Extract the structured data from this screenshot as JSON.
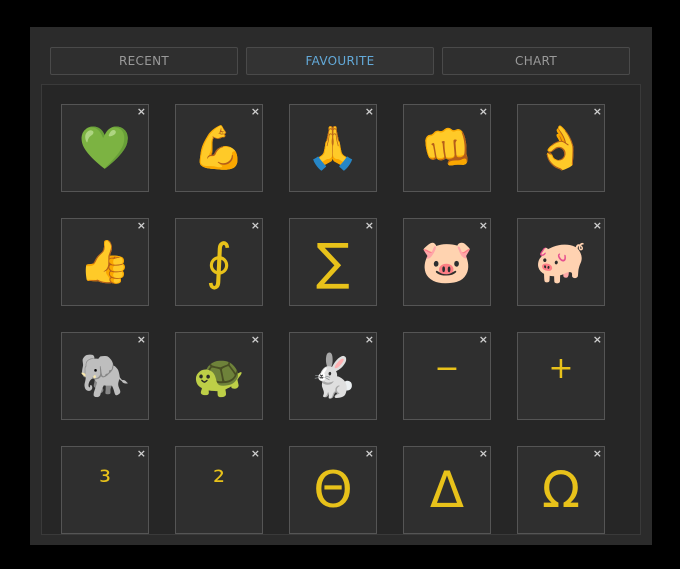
{
  "tabs": [
    {
      "label": "RECENT",
      "active": false
    },
    {
      "label": "FAVOURITE",
      "active": true
    },
    {
      "label": "CHART",
      "active": false
    }
  ],
  "accent_color": "#63a9d8",
  "symbol_color": "#e8c21a",
  "close_glyph": "×",
  "favourites": [
    {
      "symbol": "💚",
      "kind": "emoji",
      "name": "green-heart"
    },
    {
      "symbol": "💪",
      "kind": "emoji",
      "name": "flexed-biceps"
    },
    {
      "symbol": "🙏",
      "kind": "emoji",
      "name": "folded-hands"
    },
    {
      "symbol": "👊",
      "kind": "emoji",
      "name": "oncoming-fist"
    },
    {
      "symbol": "👌",
      "kind": "emoji",
      "name": "ok-hand"
    },
    {
      "symbol": "👍",
      "kind": "emoji",
      "name": "thumbs-up"
    },
    {
      "symbol": "∮",
      "kind": "math",
      "name": "contour-integral"
    },
    {
      "symbol": "∑",
      "kind": "math",
      "name": "summation"
    },
    {
      "symbol": "🐷",
      "kind": "emoji",
      "name": "pig-face"
    },
    {
      "symbol": "🐖",
      "kind": "emoji",
      "name": "pig"
    },
    {
      "symbol": "🐘",
      "kind": "emoji",
      "name": "elephant"
    },
    {
      "symbol": "🐢",
      "kind": "emoji",
      "name": "turtle"
    },
    {
      "symbol": "🐇",
      "kind": "emoji",
      "name": "rabbit"
    },
    {
      "symbol": "−",
      "kind": "math-small",
      "name": "minus"
    },
    {
      "symbol": "+",
      "kind": "math-small",
      "name": "plus"
    },
    {
      "symbol": "³",
      "kind": "math-small",
      "name": "superscript-three"
    },
    {
      "symbol": "²",
      "kind": "math-small",
      "name": "superscript-two"
    },
    {
      "symbol": "Θ",
      "kind": "math",
      "name": "theta"
    },
    {
      "symbol": "Δ",
      "kind": "math",
      "name": "delta"
    },
    {
      "symbol": "Ω",
      "kind": "math",
      "name": "omega"
    }
  ]
}
